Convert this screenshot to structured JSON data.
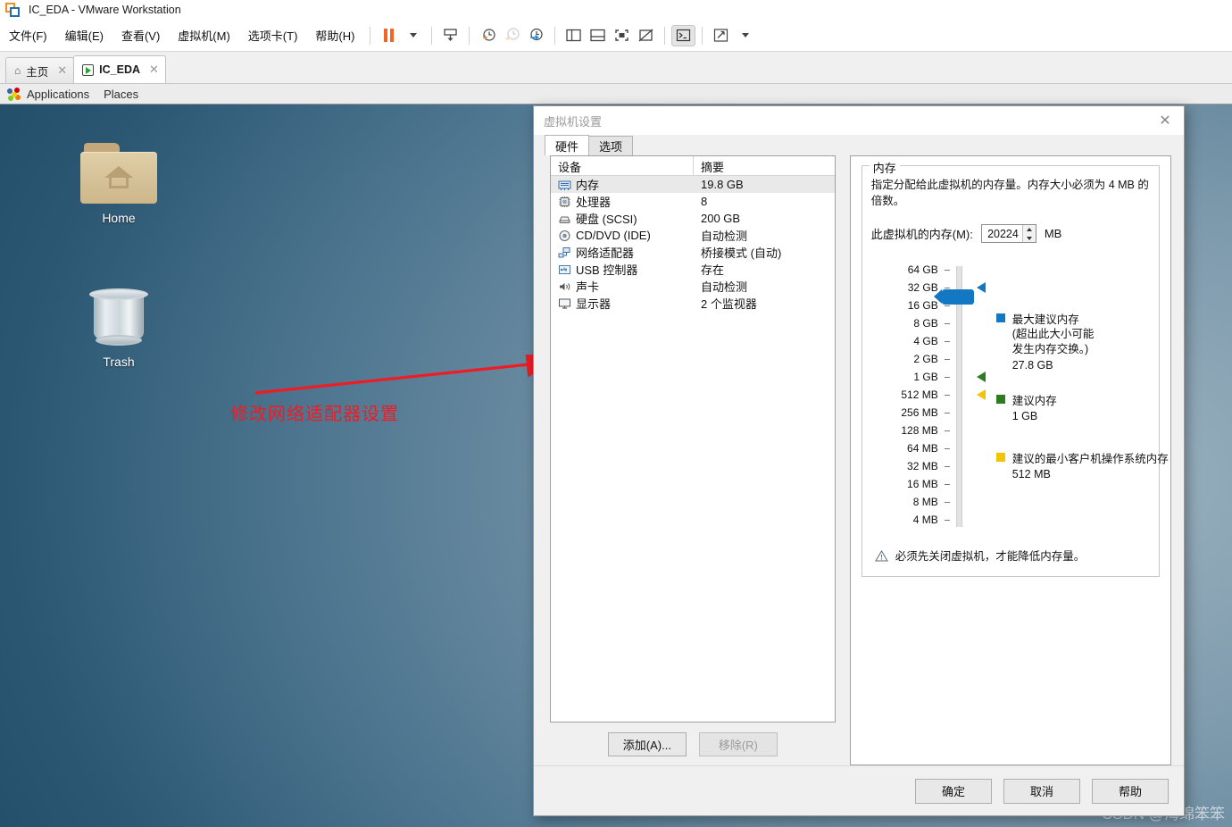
{
  "window": {
    "title": "IC_EDA - VMware Workstation",
    "logo_icon": "vmware-logo-icon"
  },
  "menubar": {
    "items": [
      {
        "label": "文件(F)",
        "name": "menu-file"
      },
      {
        "label": "编辑(E)",
        "name": "menu-edit"
      },
      {
        "label": "查看(V)",
        "name": "menu-view"
      },
      {
        "label": "虚拟机(M)",
        "name": "menu-vm"
      },
      {
        "label": "选项卡(T)",
        "name": "menu-tabs"
      },
      {
        "label": "帮助(H)",
        "name": "menu-help"
      }
    ],
    "toolbar_icons": [
      "pause-icon",
      "power-dropdown-caret-icon",
      "snapshot-icon",
      "take-snapshot-icon",
      "revert-snapshot-icon",
      "snapshot-manager-icon",
      "show-sidebar-icon",
      "show-bottom-pane-icon",
      "fullscreen-icon",
      "unity-mode-icon",
      "console-icon",
      "expand-icon",
      "expand-caret-icon"
    ]
  },
  "tabs": [
    {
      "label": "主页",
      "icon": "home-icon",
      "active": false
    },
    {
      "label": "IC_EDA",
      "icon": "vm-play-icon",
      "active": true
    }
  ],
  "guest_panel": {
    "applications": "Applications",
    "places": "Places",
    "icon": "gnome-foot-icon"
  },
  "desktop": {
    "icons": [
      {
        "label": "Home",
        "icon": "home-folder-icon"
      },
      {
        "label": "Trash",
        "icon": "trash-bin-icon"
      }
    ],
    "annotation": {
      "text": "修改网络适配器设置",
      "color": "#ee1c25",
      "arrow_icon": "red-arrow-icon"
    }
  },
  "dialog": {
    "title": "虚拟机设置",
    "close_icon": "close-icon",
    "tabs": [
      {
        "label": "硬件",
        "active": true
      },
      {
        "label": "选项",
        "active": false
      }
    ],
    "device_table": {
      "headers": [
        "设备",
        "摘要"
      ],
      "rows": [
        {
          "name": "内存",
          "summary": "19.8 GB",
          "icon": "memory-icon",
          "selected": true
        },
        {
          "name": "处理器",
          "summary": "8",
          "icon": "cpu-icon",
          "selected": false
        },
        {
          "name": "硬盘 (SCSI)",
          "summary": "200 GB",
          "icon": "harddisk-icon",
          "selected": false
        },
        {
          "name": "CD/DVD (IDE)",
          "summary": "自动检测",
          "icon": "cd-dvd-icon",
          "selected": false
        },
        {
          "name": "网络适配器",
          "summary": "桥接模式 (自动)",
          "icon": "network-adapter-icon",
          "selected": false
        },
        {
          "name": "USB 控制器",
          "summary": "存在",
          "icon": "usb-controller-icon",
          "selected": false
        },
        {
          "name": "声卡",
          "summary": "自动检测",
          "icon": "sound-card-icon",
          "selected": false
        },
        {
          "name": "显示器",
          "summary": "2 个监视器",
          "icon": "display-icon",
          "selected": false
        }
      ]
    },
    "device_buttons": {
      "add": "添加(A)...",
      "remove": "移除(R)",
      "remove_disabled": true
    },
    "memory_panel": {
      "legend": "内存",
      "description": "指定分配给此虚拟机的内存量。内存大小必须为 4 MB 的倍数。",
      "field_label": "此虚拟机的内存(M):",
      "field_value": "20224",
      "unit": "MB",
      "scale_ticks": [
        "64 GB",
        "32 GB",
        "16 GB",
        "8 GB",
        "4 GB",
        "2 GB",
        "1 GB",
        "512 MB",
        "256 MB",
        "128 MB",
        "64 MB",
        "32 MB",
        "16 MB",
        "8 MB",
        "4 MB"
      ],
      "markers": [
        {
          "name": "max-recommended-marker",
          "color": "#1477c4",
          "tick": "32 GB"
        },
        {
          "name": "recommended-marker",
          "color": "#2d7d1e",
          "tick": "1 GB"
        },
        {
          "name": "min-guest-os-marker",
          "color": "#f2c500",
          "tick": "512 MB"
        }
      ],
      "thumb": {
        "name": "memory-slider-thumb",
        "color": "#1477c4"
      },
      "legend_items": [
        {
          "color": "#1477c4",
          "title": "最大建议内存",
          "note": "(超出此大小可能\n发生内存交换。)",
          "value": "27.8 GB"
        },
        {
          "color": "#2d7d1e",
          "title": "建议内存",
          "note": "",
          "value": "1 GB"
        },
        {
          "color": "#f2c500",
          "title": "建议的最小客户机操作系统内存",
          "note": "",
          "value": "512 MB"
        }
      ],
      "warning": {
        "icon": "warning-triangle-icon",
        "text": "必须先关闭虚拟机，才能降低内存量。"
      }
    },
    "footer_buttons": [
      {
        "label": "确定",
        "name": "ok-button"
      },
      {
        "label": "取消",
        "name": "cancel-button"
      },
      {
        "label": "帮助",
        "name": "help-button"
      }
    ]
  },
  "watermark": "CSDN @海绵笨笨"
}
